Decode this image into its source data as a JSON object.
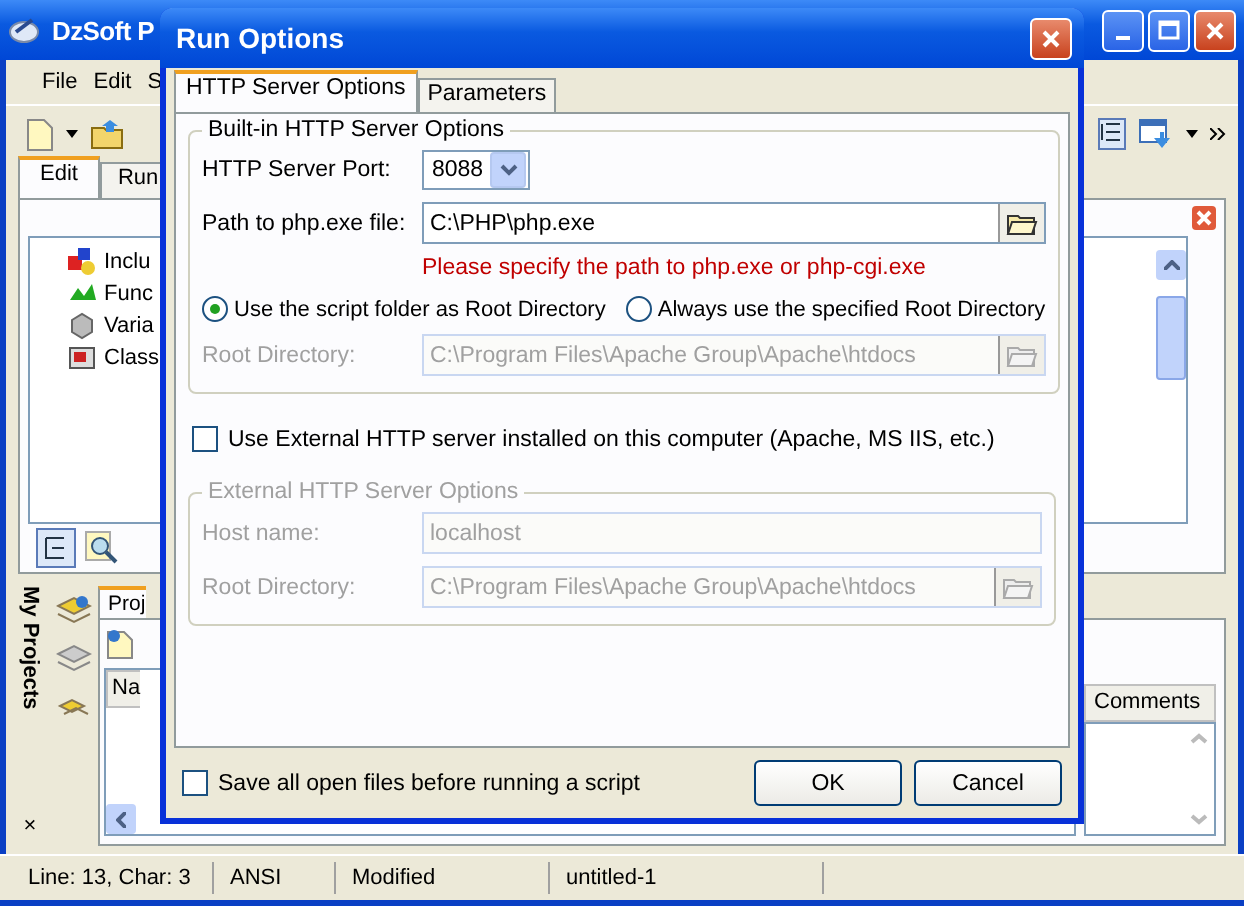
{
  "main_window": {
    "title": "DzSoft P",
    "menu": [
      "File",
      "Edit",
      "S"
    ],
    "tabs": [
      {
        "label": "Edit",
        "selected": true
      },
      {
        "label": "Run",
        "selected": false
      }
    ],
    "tree": [
      "Inclu",
      "Func",
      "Varia",
      "Class"
    ],
    "side_panel": {
      "title": "My Projects",
      "close": "×"
    },
    "project_tab": "Proj",
    "columns": [
      "Na",
      "Comments"
    ],
    "status_bar": [
      "Line: 13, Char: 3",
      "ANSI",
      "Modified",
      "untitled-1"
    ]
  },
  "dialog": {
    "title": "Run Options",
    "tabs": [
      {
        "label": "HTTP Server Options",
        "selected": true
      },
      {
        "label": "Parameters",
        "selected": false
      }
    ],
    "builtin_group": {
      "title": "Built-in HTTP Server Options",
      "port_label": "HTTP Server Port:",
      "port": "8088",
      "path_label": "Path to php.exe file:",
      "path": "C:\\PHP\\php.exe",
      "hint": "Please specify the path to php.exe or php-cgi.exe",
      "root_options": [
        {
          "label": "Use the script folder as Root Directory",
          "selected": true
        },
        {
          "label": "Always use the specified Root Directory",
          "selected": false
        }
      ],
      "root_label": "Root Directory:",
      "root": "C:\\Program Files\\Apache Group\\Apache\\htdocs",
      "root_disabled": true
    },
    "use_external": {
      "label": "Use External HTTP server installed on this computer (Apache, MS IIS, etc.)",
      "checked": false
    },
    "external_group": {
      "title": "External HTTP Server Options",
      "disabled": true,
      "host_label": "Host name:",
      "host": "localhost",
      "root_label": "Root Directory:",
      "root": "C:\\Program Files\\Apache Group\\Apache\\htdocs"
    },
    "save_all": {
      "label": "Save all open files before running a script",
      "checked": false
    },
    "buttons": [
      "OK",
      "Cancel"
    ]
  }
}
